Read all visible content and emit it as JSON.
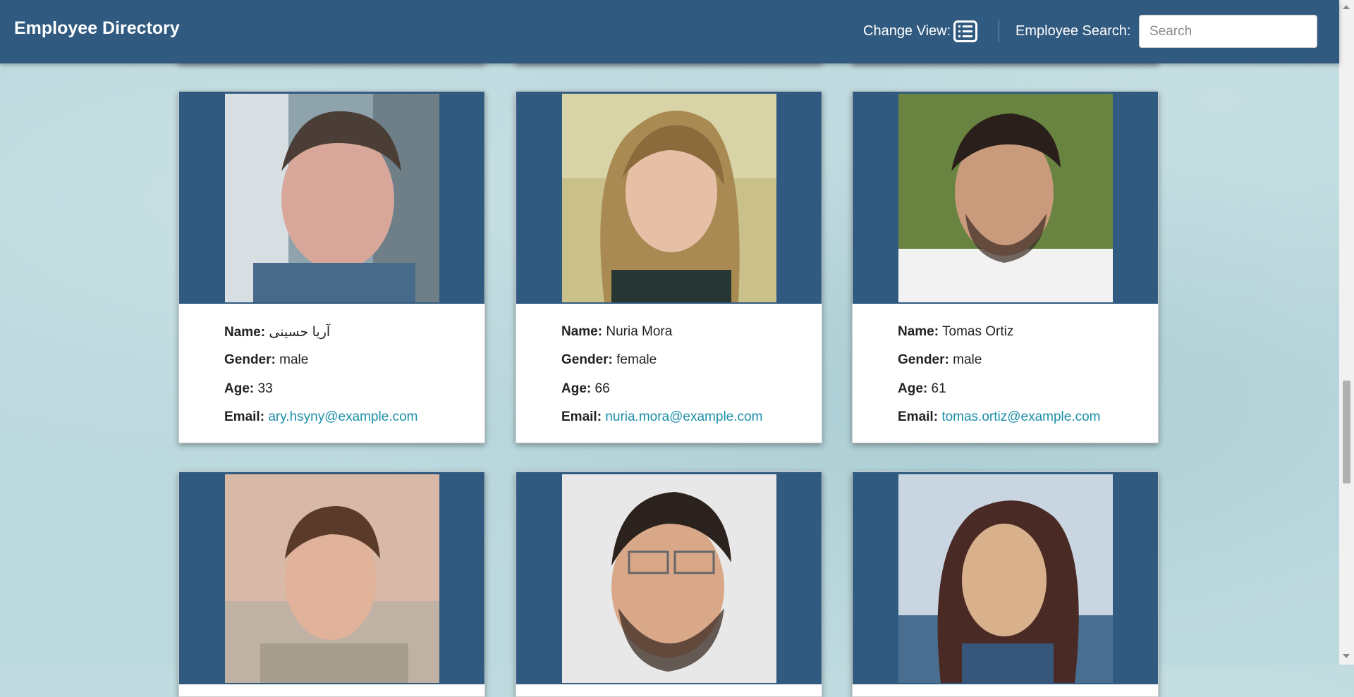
{
  "header": {
    "brand": "Employee Directory",
    "change_view_label": "Change View:",
    "change_view_icon": "list-icon",
    "search_label": "Employee Search:",
    "search_placeholder": "Search",
    "search_value": ""
  },
  "labels": {
    "name": "Name:",
    "gender": "Gender:",
    "age": "Age:",
    "email": "Email:"
  },
  "employees": [
    {
      "name": "آریا حسینی",
      "gender": "male",
      "age": "33",
      "email": "ary.hsyny@example.com"
    },
    {
      "name": "Nuria Mora",
      "gender": "female",
      "age": "66",
      "email": "nuria.mora@example.com"
    },
    {
      "name": "Tomas Ortiz",
      "gender": "male",
      "age": "61",
      "email": "tomas.ortiz@example.com"
    },
    {
      "name": "",
      "gender": "",
      "age": "",
      "email": ""
    },
    {
      "name": "",
      "gender": "",
      "age": "",
      "email": ""
    },
    {
      "name": "",
      "gender": "",
      "age": "",
      "email": ""
    }
  ],
  "colors": {
    "navbar": "#315a80",
    "link": "#1b8fa8",
    "background": "#bcd9de"
  }
}
